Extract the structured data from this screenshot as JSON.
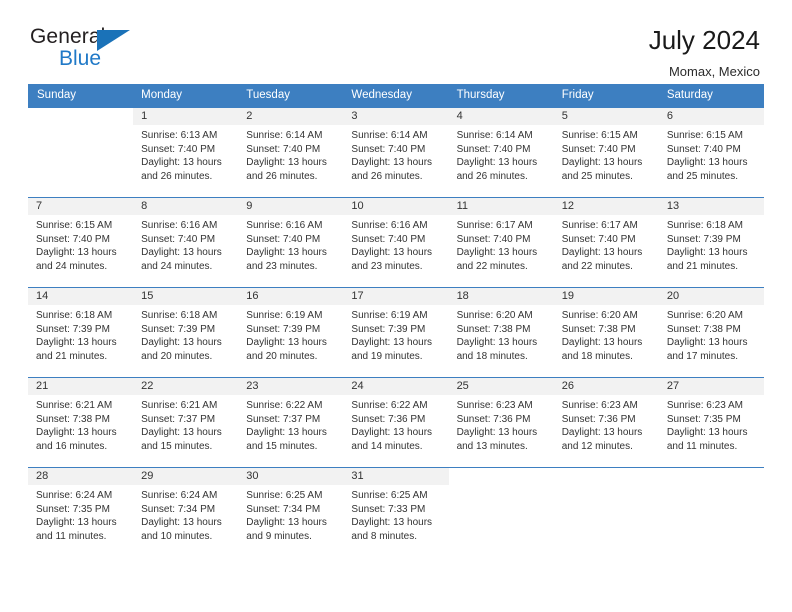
{
  "brand": {
    "name_top": "General",
    "name_bottom": "Blue",
    "accent_color": "#1a72b8"
  },
  "header": {
    "title": "July 2024",
    "subtitle": "Momax, Mexico"
  },
  "colors": {
    "header_row_bg": "#3d7fc1",
    "header_row_text": "#ffffff",
    "daynum_band_bg": "#f2f2f2",
    "cell_text": "#333333"
  },
  "weekday_headers": [
    "Sunday",
    "Monday",
    "Tuesday",
    "Wednesday",
    "Thursday",
    "Friday",
    "Saturday"
  ],
  "weeks": [
    [
      {
        "day": "",
        "sunrise": "",
        "sunset": "",
        "daylight_line1": "",
        "daylight_line2": "",
        "empty": true
      },
      {
        "day": "1",
        "sunrise": "Sunrise: 6:13 AM",
        "sunset": "Sunset: 7:40 PM",
        "daylight_line1": "Daylight: 13 hours",
        "daylight_line2": "and 26 minutes.",
        "empty": false
      },
      {
        "day": "2",
        "sunrise": "Sunrise: 6:14 AM",
        "sunset": "Sunset: 7:40 PM",
        "daylight_line1": "Daylight: 13 hours",
        "daylight_line2": "and 26 minutes.",
        "empty": false
      },
      {
        "day": "3",
        "sunrise": "Sunrise: 6:14 AM",
        "sunset": "Sunset: 7:40 PM",
        "daylight_line1": "Daylight: 13 hours",
        "daylight_line2": "and 26 minutes.",
        "empty": false
      },
      {
        "day": "4",
        "sunrise": "Sunrise: 6:14 AM",
        "sunset": "Sunset: 7:40 PM",
        "daylight_line1": "Daylight: 13 hours",
        "daylight_line2": "and 26 minutes.",
        "empty": false
      },
      {
        "day": "5",
        "sunrise": "Sunrise: 6:15 AM",
        "sunset": "Sunset: 7:40 PM",
        "daylight_line1": "Daylight: 13 hours",
        "daylight_line2": "and 25 minutes.",
        "empty": false
      },
      {
        "day": "6",
        "sunrise": "Sunrise: 6:15 AM",
        "sunset": "Sunset: 7:40 PM",
        "daylight_line1": "Daylight: 13 hours",
        "daylight_line2": "and 25 minutes.",
        "empty": false
      }
    ],
    [
      {
        "day": "7",
        "sunrise": "Sunrise: 6:15 AM",
        "sunset": "Sunset: 7:40 PM",
        "daylight_line1": "Daylight: 13 hours",
        "daylight_line2": "and 24 minutes.",
        "empty": false
      },
      {
        "day": "8",
        "sunrise": "Sunrise: 6:16 AM",
        "sunset": "Sunset: 7:40 PM",
        "daylight_line1": "Daylight: 13 hours",
        "daylight_line2": "and 24 minutes.",
        "empty": false
      },
      {
        "day": "9",
        "sunrise": "Sunrise: 6:16 AM",
        "sunset": "Sunset: 7:40 PM",
        "daylight_line1": "Daylight: 13 hours",
        "daylight_line2": "and 23 minutes.",
        "empty": false
      },
      {
        "day": "10",
        "sunrise": "Sunrise: 6:16 AM",
        "sunset": "Sunset: 7:40 PM",
        "daylight_line1": "Daylight: 13 hours",
        "daylight_line2": "and 23 minutes.",
        "empty": false
      },
      {
        "day": "11",
        "sunrise": "Sunrise: 6:17 AM",
        "sunset": "Sunset: 7:40 PM",
        "daylight_line1": "Daylight: 13 hours",
        "daylight_line2": "and 22 minutes.",
        "empty": false
      },
      {
        "day": "12",
        "sunrise": "Sunrise: 6:17 AM",
        "sunset": "Sunset: 7:40 PM",
        "daylight_line1": "Daylight: 13 hours",
        "daylight_line2": "and 22 minutes.",
        "empty": false
      },
      {
        "day": "13",
        "sunrise": "Sunrise: 6:18 AM",
        "sunset": "Sunset: 7:39 PM",
        "daylight_line1": "Daylight: 13 hours",
        "daylight_line2": "and 21 minutes.",
        "empty": false
      }
    ],
    [
      {
        "day": "14",
        "sunrise": "Sunrise: 6:18 AM",
        "sunset": "Sunset: 7:39 PM",
        "daylight_line1": "Daylight: 13 hours",
        "daylight_line2": "and 21 minutes.",
        "empty": false
      },
      {
        "day": "15",
        "sunrise": "Sunrise: 6:18 AM",
        "sunset": "Sunset: 7:39 PM",
        "daylight_line1": "Daylight: 13 hours",
        "daylight_line2": "and 20 minutes.",
        "empty": false
      },
      {
        "day": "16",
        "sunrise": "Sunrise: 6:19 AM",
        "sunset": "Sunset: 7:39 PM",
        "daylight_line1": "Daylight: 13 hours",
        "daylight_line2": "and 20 minutes.",
        "empty": false
      },
      {
        "day": "17",
        "sunrise": "Sunrise: 6:19 AM",
        "sunset": "Sunset: 7:39 PM",
        "daylight_line1": "Daylight: 13 hours",
        "daylight_line2": "and 19 minutes.",
        "empty": false
      },
      {
        "day": "18",
        "sunrise": "Sunrise: 6:20 AM",
        "sunset": "Sunset: 7:38 PM",
        "daylight_line1": "Daylight: 13 hours",
        "daylight_line2": "and 18 minutes.",
        "empty": false
      },
      {
        "day": "19",
        "sunrise": "Sunrise: 6:20 AM",
        "sunset": "Sunset: 7:38 PM",
        "daylight_line1": "Daylight: 13 hours",
        "daylight_line2": "and 18 minutes.",
        "empty": false
      },
      {
        "day": "20",
        "sunrise": "Sunrise: 6:20 AM",
        "sunset": "Sunset: 7:38 PM",
        "daylight_line1": "Daylight: 13 hours",
        "daylight_line2": "and 17 minutes.",
        "empty": false
      }
    ],
    [
      {
        "day": "21",
        "sunrise": "Sunrise: 6:21 AM",
        "sunset": "Sunset: 7:38 PM",
        "daylight_line1": "Daylight: 13 hours",
        "daylight_line2": "and 16 minutes.",
        "empty": false
      },
      {
        "day": "22",
        "sunrise": "Sunrise: 6:21 AM",
        "sunset": "Sunset: 7:37 PM",
        "daylight_line1": "Daylight: 13 hours",
        "daylight_line2": "and 15 minutes.",
        "empty": false
      },
      {
        "day": "23",
        "sunrise": "Sunrise: 6:22 AM",
        "sunset": "Sunset: 7:37 PM",
        "daylight_line1": "Daylight: 13 hours",
        "daylight_line2": "and 15 minutes.",
        "empty": false
      },
      {
        "day": "24",
        "sunrise": "Sunrise: 6:22 AM",
        "sunset": "Sunset: 7:36 PM",
        "daylight_line1": "Daylight: 13 hours",
        "daylight_line2": "and 14 minutes.",
        "empty": false
      },
      {
        "day": "25",
        "sunrise": "Sunrise: 6:23 AM",
        "sunset": "Sunset: 7:36 PM",
        "daylight_line1": "Daylight: 13 hours",
        "daylight_line2": "and 13 minutes.",
        "empty": false
      },
      {
        "day": "26",
        "sunrise": "Sunrise: 6:23 AM",
        "sunset": "Sunset: 7:36 PM",
        "daylight_line1": "Daylight: 13 hours",
        "daylight_line2": "and 12 minutes.",
        "empty": false
      },
      {
        "day": "27",
        "sunrise": "Sunrise: 6:23 AM",
        "sunset": "Sunset: 7:35 PM",
        "daylight_line1": "Daylight: 13 hours",
        "daylight_line2": "and 11 minutes.",
        "empty": false
      }
    ],
    [
      {
        "day": "28",
        "sunrise": "Sunrise: 6:24 AM",
        "sunset": "Sunset: 7:35 PM",
        "daylight_line1": "Daylight: 13 hours",
        "daylight_line2": "and 11 minutes.",
        "empty": false
      },
      {
        "day": "29",
        "sunrise": "Sunrise: 6:24 AM",
        "sunset": "Sunset: 7:34 PM",
        "daylight_line1": "Daylight: 13 hours",
        "daylight_line2": "and 10 minutes.",
        "empty": false
      },
      {
        "day": "30",
        "sunrise": "Sunrise: 6:25 AM",
        "sunset": "Sunset: 7:34 PM",
        "daylight_line1": "Daylight: 13 hours",
        "daylight_line2": "and 9 minutes.",
        "empty": false
      },
      {
        "day": "31",
        "sunrise": "Sunrise: 6:25 AM",
        "sunset": "Sunset: 7:33 PM",
        "daylight_line1": "Daylight: 13 hours",
        "daylight_line2": "and 8 minutes.",
        "empty": false
      },
      {
        "day": "",
        "sunrise": "",
        "sunset": "",
        "daylight_line1": "",
        "daylight_line2": "",
        "empty": true
      },
      {
        "day": "",
        "sunrise": "",
        "sunset": "",
        "daylight_line1": "",
        "daylight_line2": "",
        "empty": true
      },
      {
        "day": "",
        "sunrise": "",
        "sunset": "",
        "daylight_line1": "",
        "daylight_line2": "",
        "empty": true
      }
    ]
  ]
}
